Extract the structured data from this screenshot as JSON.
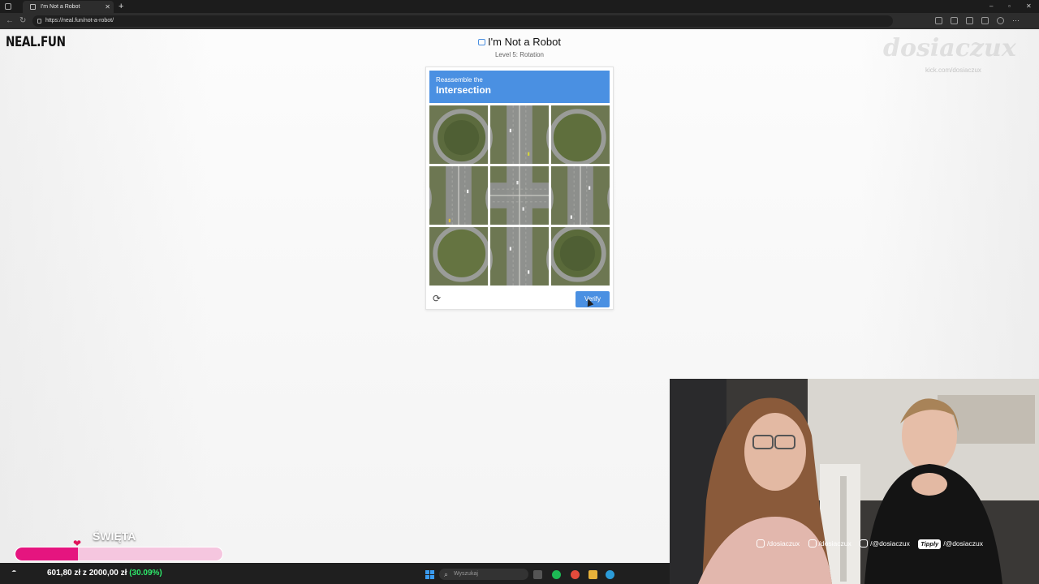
{
  "browser": {
    "tab_title": "I'm Not a Robot",
    "url": "https://neal.fun/not-a-robot/"
  },
  "page": {
    "logo": "NEAL.FUN",
    "title": "I'm Not a Robot",
    "level": "Level 5: Rotation"
  },
  "captcha": {
    "instruction_small": "Reassemble the",
    "instruction_big": "Intersection",
    "verify_label": "Verify",
    "tile_rotations_deg": [
      0,
      0,
      0,
      90,
      0,
      270,
      0,
      180,
      0
    ]
  },
  "overlay": {
    "watermark": "dosiaczux",
    "kick": "kick.com/dosiaczux",
    "goal_title": "ŚWIĘTA",
    "goal_amount": "601,80 zł z 2000,00 zł",
    "goal_percent": "(30.09%)",
    "goal_fraction": 0.3009,
    "socials": {
      "instagram": "/dosiaczux",
      "tiktok": "/dosiaczux",
      "youtube": "/@dosiaczux",
      "tippy_badge": "Tipply",
      "tippy": "/@dosiaczux"
    }
  },
  "taskbar": {
    "search_placeholder": "Wyszukaj"
  },
  "colors": {
    "captcha_blue": "#4a90e2",
    "goal_pink": "#e5157f",
    "goal_green": "#2ee86a"
  }
}
